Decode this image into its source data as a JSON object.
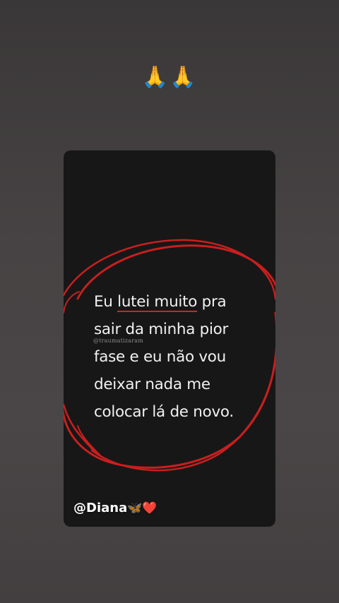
{
  "story": {
    "top_emojis": "🙏🙏",
    "quote": {
      "line1_a": "Eu ",
      "line1_highlight": "lutei muito",
      "line1_b": " pra",
      "line2": "sair da minha pior",
      "line3": "fase e eu não vou",
      "line4": "deixar nada me",
      "line5": "colocar lá de novo."
    },
    "watermark": "@traumatizaram",
    "mention": "@Diana",
    "mention_emojis": "🦋❤️",
    "colors": {
      "background": "#454142",
      "card": "#171717",
      "scribble": "#c81f1f",
      "text": "#f1f1f1"
    }
  }
}
